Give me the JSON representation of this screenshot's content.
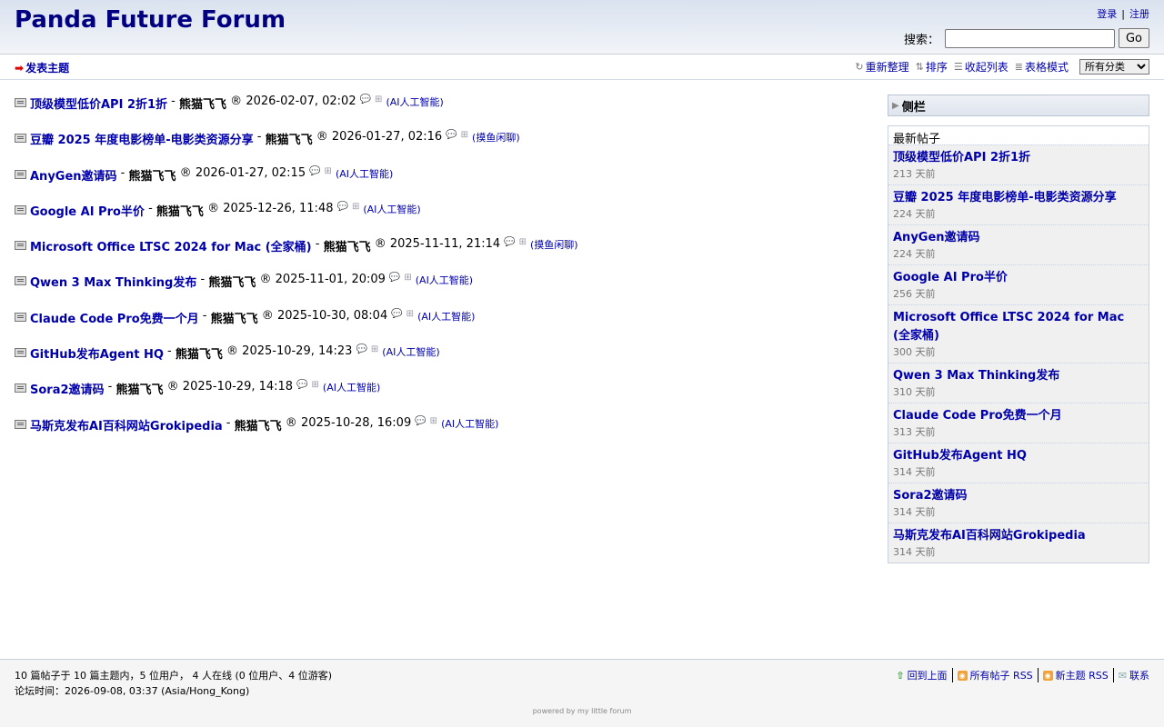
{
  "header": {
    "title": "Panda Future Forum",
    "login": "登录",
    "separator": "|",
    "register": "注册",
    "search_label": "搜索：",
    "search_value": "",
    "go_label": "Go"
  },
  "subnav": {
    "new_topic": "发表主题",
    "refresh": "重新整理",
    "sort": "排序",
    "collapse": "收起列表",
    "table_mode": "表格模式",
    "category_selected": "所有分类"
  },
  "topics": [
    {
      "title": "顶级模型低价API 2折1折",
      "author": "熊猫飞飞",
      "registered": "®",
      "date": "2026-02-07, 02:02",
      "category": "(AI人工智能)"
    },
    {
      "title": "豆瓣 2025 年度电影榜单-电影类资源分享",
      "author": "熊猫飞飞",
      "registered": "®",
      "date": "2026-01-27, 02:16",
      "category": "(摸鱼闲聊)"
    },
    {
      "title": "AnyGen邀请码",
      "author": "熊猫飞飞",
      "registered": "®",
      "date": "2026-01-27, 02:15",
      "category": "(AI人工智能)"
    },
    {
      "title": "Google AI Pro半价",
      "author": "熊猫飞飞",
      "registered": "®",
      "date": "2025-12-26, 11:48",
      "category": "(AI人工智能)"
    },
    {
      "title": "Microsoft Office LTSC 2024 for Mac (全家桶)",
      "author": "熊猫飞飞",
      "registered": "®",
      "date": "2025-11-11, 21:14",
      "category": "(摸鱼闲聊)"
    },
    {
      "title": "Qwen 3 Max Thinking发布",
      "author": "熊猫飞飞",
      "registered": "®",
      "date": "2025-11-01, 20:09",
      "category": "(AI人工智能)"
    },
    {
      "title": "Claude Code Pro免费一个月",
      "author": "熊猫飞飞",
      "registered": "®",
      "date": "2025-10-30, 08:04",
      "category": "(AI人工智能)"
    },
    {
      "title": "GitHub发布Agent HQ",
      "author": "熊猫飞飞",
      "registered": "®",
      "date": "2025-10-29, 14:23",
      "category": "(AI人工智能)"
    },
    {
      "title": "Sora2邀请码",
      "author": "熊猫飞飞",
      "registered": "®",
      "date": "2025-10-29, 14:18",
      "category": "(AI人工智能)"
    },
    {
      "title": "马斯克发布AI百科网站Grokipedia",
      "author": "熊猫飞飞",
      "registered": "®",
      "date": "2025-10-28, 16:09",
      "category": "(AI人工智能)"
    }
  ],
  "sidebar": {
    "title": "侧栏",
    "latest_heading": "最新帖子",
    "latest": [
      {
        "title": "顶级模型低价API 2折1折",
        "age": "213 天前"
      },
      {
        "title": "豆瓣 2025 年度电影榜单-电影类资源分享",
        "age": "224 天前"
      },
      {
        "title": "AnyGen邀请码",
        "age": "224 天前"
      },
      {
        "title": "Google AI Pro半价",
        "age": "256 天前"
      },
      {
        "title": "Microsoft Office LTSC 2024 for Mac (全家桶)",
        "age": "300 天前"
      },
      {
        "title": "Qwen 3 Max Thinking发布",
        "age": "310 天前"
      },
      {
        "title": "Claude Code Pro免费一个月",
        "age": "313 天前"
      },
      {
        "title": "GitHub发布Agent HQ",
        "age": "314 天前"
      },
      {
        "title": "Sora2邀请码",
        "age": "314 天前"
      },
      {
        "title": "马斯克发布AI百科网站Grokipedia",
        "age": "314 天前"
      }
    ]
  },
  "footer": {
    "stats": "10 篇帖子于 10 篇主题内，5 位用户， 4 人在线 (0 位用户、4 位游客)",
    "time": "论坛时间：2026-09-08, 03:37 (Asia/Hong_Kong)",
    "back_top": "回到上面",
    "all_posts_rss": "所有帖子 RSS",
    "new_topics_rss": "新主题 RSS",
    "contact": "联系",
    "powered": "powered by my little forum"
  },
  "icons": {
    "new_topic": "red-arrow-icon",
    "topic": "thread-icon",
    "rss": "rss-icon",
    "contact": "mail-icon"
  },
  "colors": {
    "link": "#0000aa",
    "title": "#000080",
    "arrow": "#e00000",
    "rss": "#f3a23a"
  }
}
